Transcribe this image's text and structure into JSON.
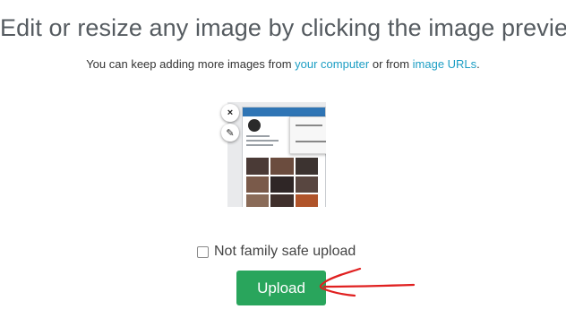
{
  "header": {
    "title": "Edit or resize any image by clicking the image preview",
    "subtitle_prefix": "You can keep adding more images from ",
    "link_computer": "your computer",
    "subtitle_middle": " or from ",
    "link_urls": "image URLs",
    "subtitle_suffix": "."
  },
  "preview": {
    "remove_icon": "×",
    "edit_icon": "✎"
  },
  "options": {
    "not_family_safe_label": "Not family safe upload",
    "not_family_safe_checked": false
  },
  "actions": {
    "upload_label": "Upload"
  },
  "colors": {
    "link": "#1c9ec4",
    "upload_button": "#29a55c",
    "annotation_arrow": "#e02020"
  }
}
